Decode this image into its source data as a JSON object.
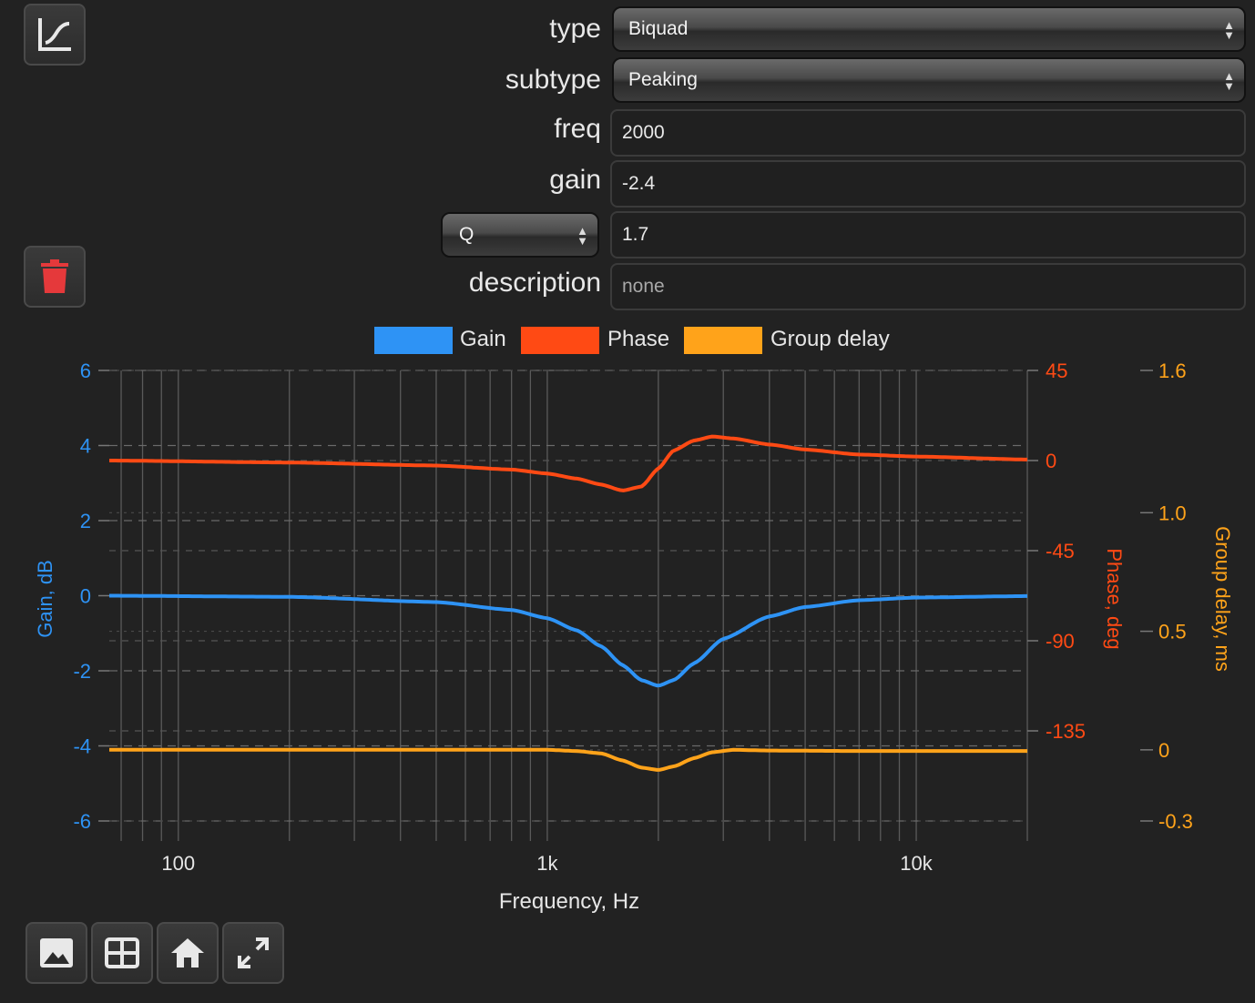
{
  "form": {
    "type_label": "type",
    "type_value": "Biquad",
    "subtype_label": "subtype",
    "subtype_value": "Peaking",
    "freq_label": "freq",
    "freq_value": "2000",
    "gain_label": "gain",
    "gain_value": "-2.4",
    "q_select_value": "Q",
    "q_value": "1.7",
    "description_label": "description",
    "description_placeholder": "none"
  },
  "toolbar": {
    "top_icon": "line-chart-icon",
    "delete_icon": "trash-icon",
    "bottom_icons": [
      "image-icon",
      "table-icon",
      "home-icon",
      "expand-icon"
    ]
  },
  "chart_data": {
    "type": "line",
    "xlabel": "Frequency, Hz",
    "ylabel": "Gain, dB",
    "y2label": "Phase, deg",
    "y3label": "Group delay, ms",
    "xscale": "log",
    "xlim": [
      65,
      20000
    ],
    "ylim": [
      -6,
      6
    ],
    "y2lim": [
      -180,
      45
    ],
    "y3lim": [
      -0.3,
      1.6
    ],
    "xticks": [
      "100",
      "1k",
      "10k"
    ],
    "yticks": [
      "6",
      "4",
      "2",
      "0",
      "-2",
      "-4",
      "-6"
    ],
    "y2ticks": [
      "45",
      "0",
      "-45",
      "-90",
      "-135"
    ],
    "y3ticks": [
      "1.6",
      "1.0",
      "0.5",
      "0",
      "-0.3"
    ],
    "grid": true,
    "legend_position": "top-center",
    "series": [
      {
        "name": "Gain",
        "axis": "y",
        "color": "#2e93f5",
        "x": [
          65,
          200,
          500,
          800,
          1000,
          1200,
          1400,
          1600,
          1800,
          2000,
          2200,
          2500,
          3000,
          4000,
          5000,
          7000,
          10000,
          20000
        ],
        "y": [
          0,
          -0.03,
          -0.17,
          -0.38,
          -0.6,
          -0.92,
          -1.35,
          -1.85,
          -2.25,
          -2.4,
          -2.25,
          -1.8,
          -1.15,
          -0.55,
          -0.3,
          -0.12,
          -0.05,
          -0.01
        ]
      },
      {
        "name": "Phase",
        "axis": "y2",
        "color": "#ff4a14",
        "x": [
          65,
          200,
          500,
          800,
          1000,
          1200,
          1400,
          1600,
          1800,
          2000,
          2200,
          2500,
          2800,
          3200,
          4000,
          5000,
          7000,
          10000,
          20000
        ],
        "y": [
          0,
          -1,
          -2.5,
          -4.5,
          -6.5,
          -9,
          -12,
          -15,
          -13,
          -4,
          5,
          10,
          12,
          11,
          8,
          5.5,
          3,
          2,
          0.5
        ]
      },
      {
        "name": "Group delay",
        "axis": "y3",
        "color": "#ffa31a",
        "x": [
          65,
          300,
          1000,
          1200,
          1400,
          1600,
          1800,
          2000,
          2200,
          2500,
          2800,
          3200,
          4000,
          7000,
          20000
        ],
        "y": [
          0.0,
          0.0,
          0.0,
          -0.005,
          -0.015,
          -0.045,
          -0.075,
          -0.085,
          -0.07,
          -0.035,
          -0.01,
          0.0,
          -0.003,
          -0.005,
          -0.005
        ]
      }
    ]
  }
}
